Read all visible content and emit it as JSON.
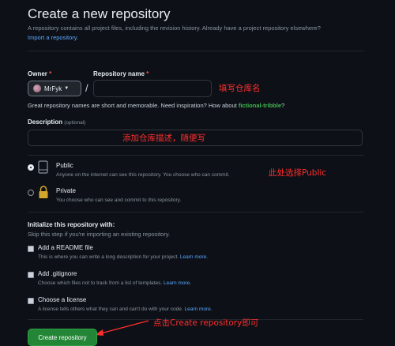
{
  "header": {
    "title": "Create a new repository",
    "subtitle": "A repository contains all project files, including the revision history. Already have a project repository elsewhere?",
    "import_link": "Import a repository."
  },
  "owner": {
    "label": "Owner",
    "required": "*",
    "value": "MrFyk"
  },
  "repo_name": {
    "label": "Repository name",
    "required": "*",
    "value": ""
  },
  "name_hint": {
    "text": "Great repository names are short and memorable. Need inspiration? How about",
    "suggestion": "fictional-tribble",
    "end": "?"
  },
  "description": {
    "label": "Description",
    "optional": "(optional)",
    "value": ""
  },
  "visibility": {
    "public": {
      "title": "Public",
      "desc": "Anyone on the internet can see this repository. You choose who can commit.",
      "selected": true
    },
    "private": {
      "title": "Private",
      "desc": "You choose who can see and commit to this repository.",
      "selected": false
    }
  },
  "init": {
    "title": "Initialize this repository with:",
    "subtitle": "Skip this step if you're importing an existing repository.",
    "readme": {
      "title": "Add a README file",
      "desc": "This is where you can write a long description for your project.",
      "link": "Learn more."
    },
    "gitignore": {
      "title": "Add .gitignore",
      "desc": "Choose which files not to track from a list of templates.",
      "link": "Learn more."
    },
    "license": {
      "title": "Choose a license",
      "desc": "A license tells others what they can and can't do with your code.",
      "link": "Learn more."
    }
  },
  "create_button": "Create repository",
  "annotations": {
    "name": "填写仓库名",
    "description": "添加仓库描述，随便写",
    "public": "此处选择Public",
    "create": "点击Create repository即可"
  },
  "colors": {
    "background": "#0d1117",
    "link": "#58a6ff",
    "green": "#3fb950",
    "button": "#238636",
    "annotation": "#ff2d2d"
  }
}
